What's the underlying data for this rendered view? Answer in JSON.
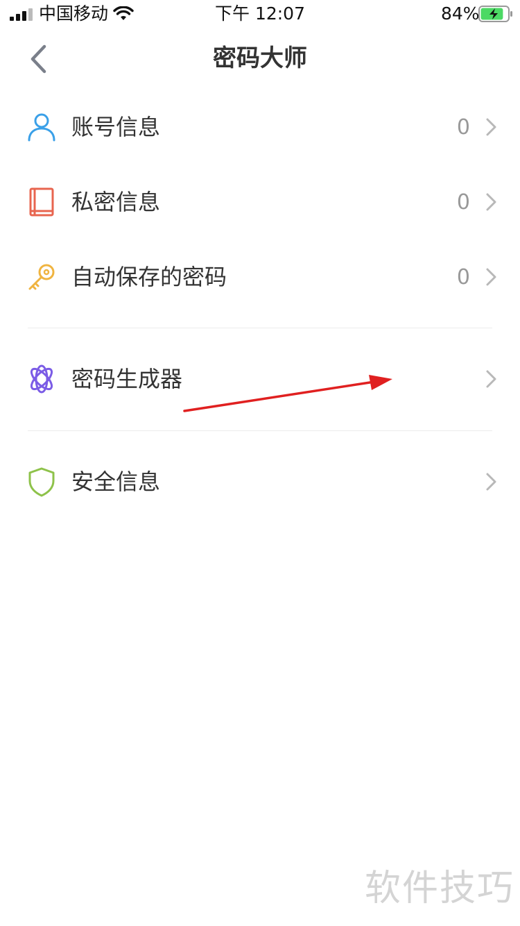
{
  "status_bar": {
    "carrier": "中国移动",
    "time": "下午 12:07",
    "battery_percent": "84%",
    "battery_level": 0.84,
    "battery_color": "#4cd964"
  },
  "nav": {
    "title": "密码大师",
    "back_icon": "chevron-left-icon"
  },
  "menu": {
    "group1": [
      {
        "label": "账号信息",
        "count": "0",
        "icon": "user-icon",
        "icon_color": "#3aa0e8"
      },
      {
        "label": "私密信息",
        "count": "0",
        "icon": "book-icon",
        "icon_color": "#e8654f"
      },
      {
        "label": "自动保存的密码",
        "count": "0",
        "icon": "key-icon",
        "icon_color": "#f0b440"
      }
    ],
    "group2": [
      {
        "label": "密码生成器",
        "icon": "atom-icon",
        "icon_color": "#7b5ce6"
      }
    ],
    "group3": [
      {
        "label": "安全信息",
        "icon": "shield-icon",
        "icon_color": "#8ec24a"
      }
    ]
  },
  "annotation": {
    "arrow_color": "#e02020"
  },
  "watermark": "软件技巧"
}
